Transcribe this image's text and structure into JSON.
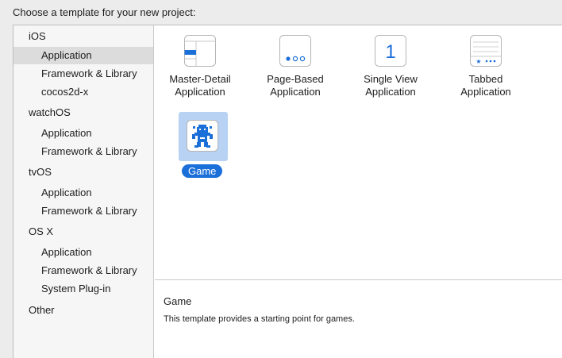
{
  "header": {
    "title": "Choose a template for your new project:"
  },
  "sidebar": {
    "groups": [
      {
        "label": "iOS",
        "items": [
          "Application",
          "Framework & Library",
          "cocos2d-x"
        ]
      },
      {
        "label": "watchOS",
        "items": [
          "Application",
          "Framework & Library"
        ]
      },
      {
        "label": "tvOS",
        "items": [
          "Application",
          "Framework & Library"
        ]
      },
      {
        "label": "OS X",
        "items": [
          "Application",
          "Framework & Library",
          "System Plug-in"
        ]
      },
      {
        "label": "Other",
        "items": []
      }
    ],
    "selected": "iOS / Application"
  },
  "templates": [
    {
      "line1": "Master-Detail",
      "line2": "Application",
      "icon": "master-detail-icon"
    },
    {
      "line1": "Page-Based",
      "line2": "Application",
      "icon": "page-based-icon"
    },
    {
      "line1": "Single View",
      "line2": "Application",
      "icon": "single-view-icon",
      "glyph": "1"
    },
    {
      "line1": "Tabbed",
      "line2": "Application",
      "icon": "tabbed-icon"
    },
    {
      "line1": "Game",
      "icon": "game-icon",
      "selected": true
    }
  ],
  "description": {
    "title": "Game",
    "text": "This template provides a starting point for games."
  },
  "colors": {
    "accent": "#1b6fd8",
    "selection_bg": "#b7d2f2",
    "sidebar_selected": "#dcdcdc"
  }
}
